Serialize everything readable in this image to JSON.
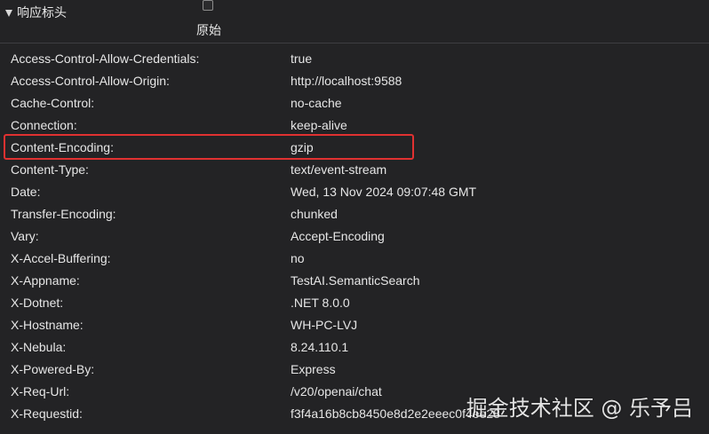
{
  "section": {
    "title": "响应标头",
    "raw_label": "原始"
  },
  "headers": [
    {
      "name": "Access-Control-Allow-Credentials:",
      "value": "true"
    },
    {
      "name": "Access-Control-Allow-Origin:",
      "value": "http://localhost:9588"
    },
    {
      "name": "Cache-Control:",
      "value": "no-cache"
    },
    {
      "name": "Connection:",
      "value": "keep-alive"
    },
    {
      "name": "Content-Encoding:",
      "value": "gzip"
    },
    {
      "name": "Content-Type:",
      "value": "text/event-stream"
    },
    {
      "name": "Date:",
      "value": "Wed, 13 Nov 2024 09:07:48 GMT"
    },
    {
      "name": "Transfer-Encoding:",
      "value": "chunked"
    },
    {
      "name": "Vary:",
      "value": "Accept-Encoding"
    },
    {
      "name": "X-Accel-Buffering:",
      "value": "no"
    },
    {
      "name": "X-Appname:",
      "value": "TestAI.SemanticSearch"
    },
    {
      "name": "X-Dotnet:",
      "value": ".NET 8.0.0"
    },
    {
      "name": "X-Hostname:",
      "value": "WH-PC-LVJ"
    },
    {
      "name": "X-Nebula:",
      "value": "8.24.110.1"
    },
    {
      "name": "X-Powered-By:",
      "value": "Express"
    },
    {
      "name": "X-Req-Url:",
      "value": "/v20/openai/chat"
    },
    {
      "name": "X-Requestid:",
      "value": "f3f4a16b8cb8450e8d2e2eeec0f4ee28"
    }
  ],
  "watermark": "掘金技术社区 @ 乐予吕",
  "colors": {
    "background": "#232325",
    "text": "#e6e6e6",
    "highlight": "#e03131"
  }
}
